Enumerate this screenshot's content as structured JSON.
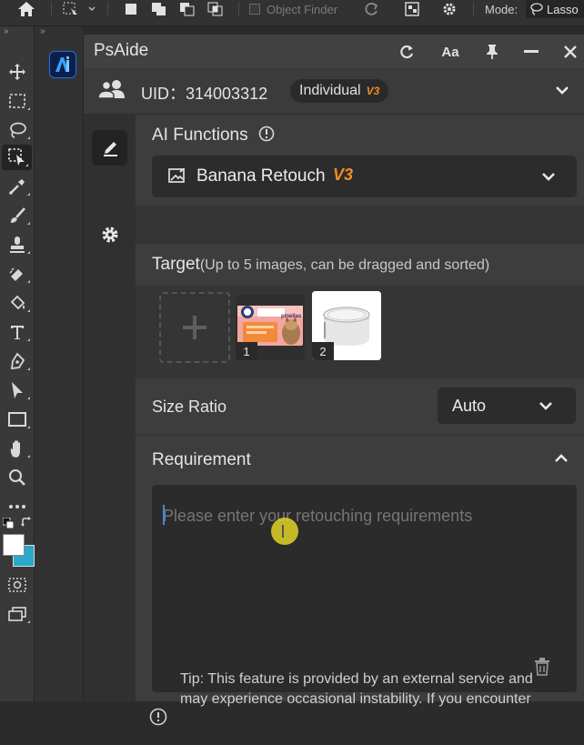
{
  "topbar": {
    "object_finder_label": "Object Finder",
    "mode_label": "Mode:",
    "mode_value": "Lasso"
  },
  "panel": {
    "title": "PsAide",
    "header_icons": [
      "refresh-icon",
      "font-size-icon",
      "pin-icon",
      "minimize-icon",
      "close-icon"
    ]
  },
  "account": {
    "uid_text": "UID：314003312",
    "plan_label": "Individual",
    "version_badge": "V3"
  },
  "ai_functions": {
    "label": "AI Functions",
    "selected": "Banana Retouch",
    "selected_version": "V3"
  },
  "target": {
    "label": "Target",
    "hint": "(Up to 5 images, can be dragged and sorted)",
    "images": [
      {
        "index": "1",
        "brand_text": "pinellas"
      },
      {
        "index": "2"
      }
    ]
  },
  "size_ratio": {
    "label": "Size Ratio",
    "value": "Auto"
  },
  "requirement": {
    "label": "Requirement",
    "placeholder": "Please enter your retouching requirements"
  },
  "tip": {
    "line1": "Tip: This feature is provided by an external service and",
    "line2": "may experience occasional instability. If you encounter"
  },
  "colors": {
    "accent_orange": "#f28c28",
    "teal_background_swatch": "#2aa9c9",
    "logo_blue": "#1e6fe6"
  }
}
